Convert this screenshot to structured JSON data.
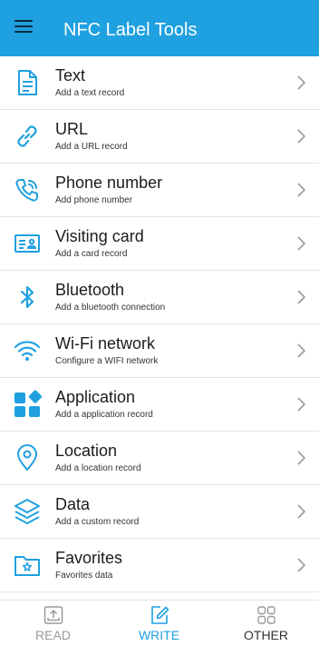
{
  "colors": {
    "accent": "#1fa0e0",
    "appbar": "#1fa0e0",
    "inactive_tab": "#9a9a9a",
    "other_tab": "#333333"
  },
  "appbar": {
    "title": "NFC Label Tools",
    "menu_icon": "menu-icon"
  },
  "items": [
    {
      "title": "Text",
      "subtitle": "Add a text record",
      "icon": "document-icon"
    },
    {
      "title": "URL",
      "subtitle": "Add a URL record",
      "icon": "link-icon"
    },
    {
      "title": "Phone number",
      "subtitle": "Add phone number",
      "icon": "phone-icon"
    },
    {
      "title": "Visiting card",
      "subtitle": "Add a card record",
      "icon": "contact-card-icon"
    },
    {
      "title": "Bluetooth",
      "subtitle": "Add a bluetooth connection",
      "icon": "bluetooth-icon"
    },
    {
      "title": "Wi-Fi network",
      "subtitle": "Configure a WIFI network",
      "icon": "wifi-icon"
    },
    {
      "title": "Application",
      "subtitle": "Add a application record",
      "icon": "app-grid-icon"
    },
    {
      "title": "Location",
      "subtitle": "Add a location record",
      "icon": "location-pin-icon"
    },
    {
      "title": "Data",
      "subtitle": "Add a custom record",
      "icon": "layers-icon"
    },
    {
      "title": "Favorites",
      "subtitle": "Favorites data",
      "icon": "favorites-folder-icon"
    }
  ],
  "tabs": [
    {
      "label": "READ",
      "icon": "read-icon",
      "active": false
    },
    {
      "label": "WRITE",
      "icon": "write-icon",
      "active": true
    },
    {
      "label": "OTHER",
      "icon": "other-grid-icon",
      "active": false
    }
  ]
}
